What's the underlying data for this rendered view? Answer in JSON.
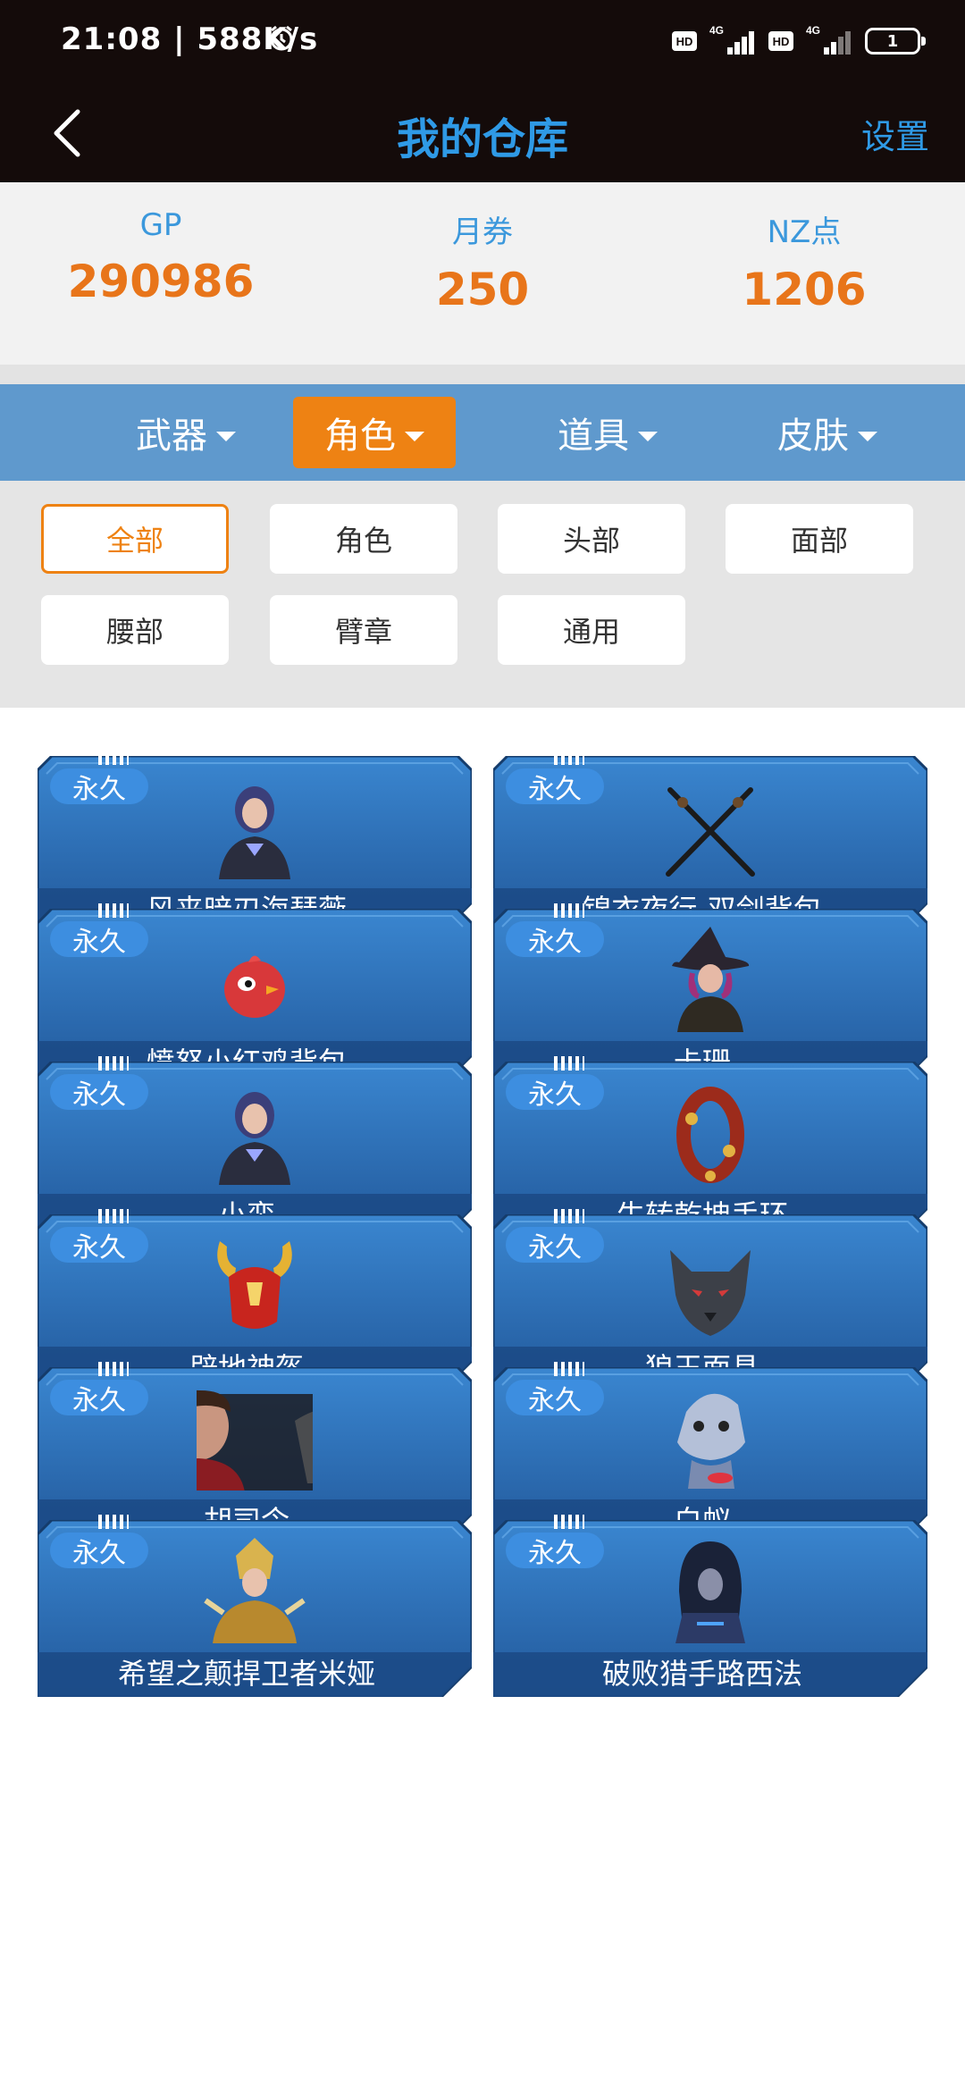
{
  "status_bar": {
    "time": "21:08 | 588K/s",
    "hd_1": "HD",
    "net_1": "4G",
    "hd_2": "HD",
    "net_2": "4G",
    "battery": "1"
  },
  "header": {
    "title": "我的仓库",
    "settings": "设置"
  },
  "currencies": [
    {
      "label": "GP",
      "value": "290986"
    },
    {
      "label": "月券",
      "value": "250"
    },
    {
      "label": "NZ点",
      "value": "1206"
    }
  ],
  "category_tabs": [
    {
      "label": "武器",
      "active": false
    },
    {
      "label": "角色",
      "active": true
    },
    {
      "label": "道具",
      "active": false
    },
    {
      "label": "皮肤",
      "active": false
    }
  ],
  "filters": [
    {
      "label": "全部",
      "active": true
    },
    {
      "label": "角色",
      "active": false
    },
    {
      "label": "头部",
      "active": false
    },
    {
      "label": "面部",
      "active": false
    },
    {
      "label": "腰部",
      "active": false
    },
    {
      "label": "臂章",
      "active": false
    },
    {
      "label": "通用",
      "active": false
    }
  ],
  "items": [
    {
      "badge": "永久",
      "name": "风来暗刃海瑟薇",
      "icon": "female-character-portrait"
    },
    {
      "badge": "永久",
      "name": "锦衣夜行-双剑背包",
      "icon": "crossed-swords"
    },
    {
      "badge": "永久",
      "name": "愤怒小红鸡背包",
      "icon": "red-chick"
    },
    {
      "badge": "永久",
      "name": "卡珊",
      "icon": "witch-character-portrait"
    },
    {
      "badge": "永久",
      "name": "小蛮",
      "icon": "female-character-portrait"
    },
    {
      "badge": "永久",
      "name": "牛转乾坤手环",
      "icon": "bracelet"
    },
    {
      "badge": "永久",
      "name": "辟地神盔",
      "icon": "horned-helmet"
    },
    {
      "badge": "永久",
      "name": "狼王面具",
      "icon": "wolf-mask"
    },
    {
      "badge": "永久",
      "name": "胡司令",
      "icon": "male-character-portrait"
    },
    {
      "badge": "永久",
      "name": "白蚁",
      "icon": "masked-character"
    },
    {
      "badge": "永久",
      "name": "希望之颠捍卫者米娅",
      "icon": "armored-character"
    },
    {
      "badge": "永久",
      "name": "破败猎手路西法",
      "icon": "hooded-character"
    }
  ],
  "colors": {
    "header_bg": "#140b0a",
    "title_blue": "#2f9ae6",
    "accent_orange": "#ee8213",
    "value_orange": "#e8751a",
    "tab_bar_blue": "#5f99cd",
    "card_blue": "#2c69b0"
  }
}
